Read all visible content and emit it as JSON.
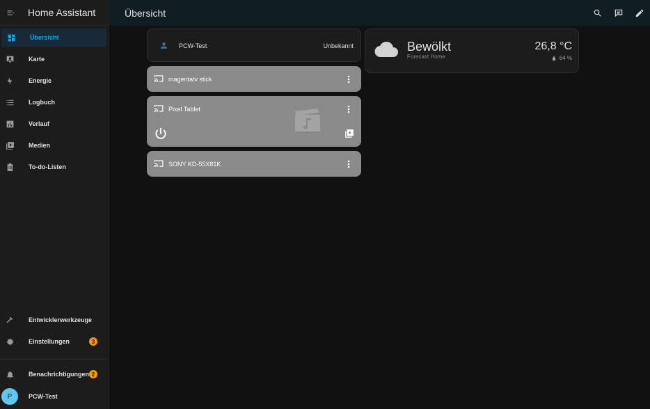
{
  "sidebar": {
    "title": "Home Assistant",
    "items": [
      {
        "label": "Übersicht",
        "icon": "dashboard-icon"
      },
      {
        "label": "Karte",
        "icon": "map-account-icon"
      },
      {
        "label": "Energie",
        "icon": "lightning-bolt-icon"
      },
      {
        "label": "Logbuch",
        "icon": "format-list-bulleted-icon"
      },
      {
        "label": "Verlauf",
        "icon": "chart-box-icon"
      },
      {
        "label": "Medien",
        "icon": "play-box-multiple-icon"
      },
      {
        "label": "To-do-Listen",
        "icon": "clipboard-list-icon"
      }
    ],
    "bottom": {
      "dev_tools": "Entwicklerwerkzeuge",
      "settings": "Einstellungen",
      "settings_badge": "3",
      "notifications": "Benachrichtigungen",
      "notifications_badge": "2",
      "user_name": "PCW-Test",
      "user_initial": "P"
    }
  },
  "topbar": {
    "title": "Übersicht",
    "actions": [
      "search-icon",
      "assist-icon",
      "edit-icon"
    ]
  },
  "cards": {
    "person": {
      "name": "PCW-Test",
      "state": "Unbekannt"
    },
    "media": [
      {
        "name": "magentatv stick"
      },
      {
        "name": "Pixel Tablet"
      },
      {
        "name": "SONY KD-55X81K"
      }
    ],
    "weather": {
      "condition": "Bewölkt",
      "location": "Forecast Home",
      "temperature": "26,8 °C",
      "humidity": "64 %"
    }
  },
  "colors": {
    "accent": "#03a9f4",
    "badge": "#ff9800",
    "topbar": "#101e24",
    "media_card": "#8a8a8a"
  }
}
